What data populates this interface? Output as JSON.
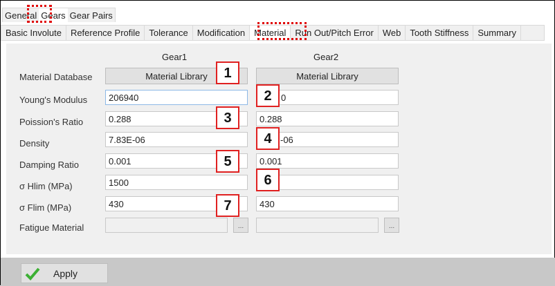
{
  "top_tabs": [
    "General",
    "Gears",
    "Gear Pairs"
  ],
  "sub_tabs": [
    "Basic Involute",
    "Reference Profile",
    "Tolerance",
    "Modification",
    "Material",
    "Run Out/Pitch Error",
    "Web",
    "Tooth Stiffness",
    "Summary"
  ],
  "active_sub_tab": "Material",
  "columns": {
    "gear1": "Gear1",
    "gear2": "Gear2"
  },
  "rows": {
    "material_database": {
      "label": "Material Database",
      "gear1": "Material Library",
      "gear2": "Material Library"
    },
    "youngs_modulus": {
      "label": "Young's Modulus",
      "gear1": "206940",
      "gear2": "0"
    },
    "poissons_ratio": {
      "label": "Poission's Ratio",
      "gear1": "0.288",
      "gear2": "0.288"
    },
    "density": {
      "label": "Density",
      "gear1": "7.83E-06",
      "gear2": "-06"
    },
    "damping_ratio": {
      "label": "Damping Ratio",
      "gear1": "0.001",
      "gear2": "0.001"
    },
    "sigma_hlim": {
      "label": "σ Hlim (MPa)",
      "gear1": "1500",
      "gear2": ""
    },
    "sigma_flim": {
      "label": "σ Flim (MPa)",
      "gear1": "430",
      "gear2": "430"
    },
    "fatigue_material": {
      "label": "Fatigue Material",
      "gear1": "",
      "gear2": "",
      "browse": "..."
    }
  },
  "annotations": [
    "1",
    "2",
    "3",
    "4",
    "5",
    "6",
    "7"
  ],
  "apply_label": "Apply",
  "colors": {
    "annotation": "#e02020",
    "panel": "#f0f0f0",
    "bottom_bar": "#c8c8c8",
    "apply_check": "#3cb034"
  }
}
